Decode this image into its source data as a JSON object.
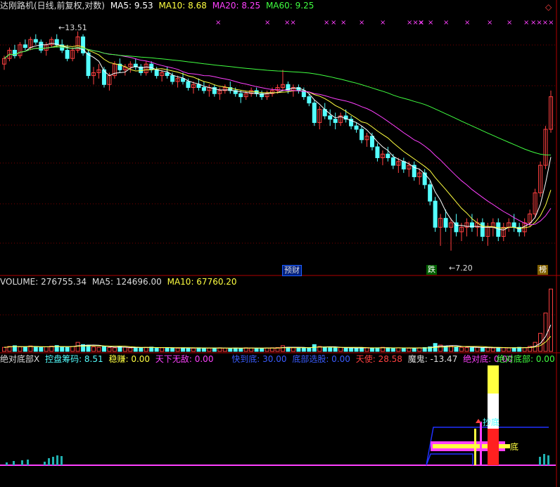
{
  "header": {
    "title": "达刚路机(日线,前复权,对数)",
    "ma5_label": "MA5: 9.53",
    "ma10_label": "MA10: 8.68",
    "ma20_label": "MA20: 8.25",
    "ma60_label": "MA60: 9.25",
    "diamond": "◇"
  },
  "colors": {
    "up": "#ff4040",
    "down": "#54ffff",
    "ma5": "#ffffff",
    "ma10": "#ffff40",
    "ma20": "#ff40ff",
    "ma60": "#40ff40",
    "grid": "#7a0000",
    "axis": "#b00000"
  },
  "price": {
    "high_label": "13.51",
    "low_label": "7.20",
    "tag_a": "预财",
    "tag_b": "跌",
    "tag_c": "榜",
    "x_marks": [
      "×",
      "×",
      "××",
      "×",
      "×",
      "×",
      "×",
      "×",
      "×××",
      "×",
      "×",
      "×",
      "×",
      "×",
      "×",
      "×",
      "××××"
    ]
  },
  "volume": {
    "label": "VOLUME: 276755.34",
    "ma5": "MA5: 124696.00",
    "ma10": "MA10: 67760.20"
  },
  "indicator": {
    "name": "绝对底部X",
    "kpcm": "控盘筹码: 8.51",
    "wenz": "稳赚: 0.00",
    "tianxia": "天下无敌: 0.00",
    "kuaidaodi": "快到底: 30.00",
    "dibu": "底部选股: 0.00",
    "tianshi": "天使: 28.58",
    "mogui": "魔鬼: -13.47",
    "juedidi": "绝对底: 0.00",
    "juedibu": "绝对底部: 0.00",
    "chaodi": "抄底",
    "dilabel": "底"
  },
  "chart_data": {
    "type": "candlestick",
    "price_axis": "log",
    "y_range": [
      6.8,
      14.2
    ],
    "candles": [
      [
        12.3,
        12.6,
        12.1,
        12.5
      ],
      [
        12.5,
        12.9,
        12.4,
        12.8
      ],
      [
        12.8,
        13.0,
        12.5,
        12.6
      ],
      [
        12.6,
        13.1,
        12.5,
        13.0
      ],
      [
        13.0,
        13.2,
        12.8,
        12.9
      ],
      [
        12.9,
        13.3,
        12.8,
        13.2
      ],
      [
        13.2,
        13.4,
        13.0,
        13.1
      ],
      [
        13.1,
        13.2,
        12.7,
        12.8
      ],
      [
        12.8,
        13.1,
        12.6,
        13.0
      ],
      [
        13.0,
        13.3,
        12.9,
        13.2
      ],
      [
        13.2,
        13.4,
        12.9,
        13.0
      ],
      [
        13.0,
        13.2,
        12.7,
        12.8
      ],
      [
        12.8,
        13.0,
        12.4,
        12.5
      ],
      [
        12.5,
        12.9,
        12.4,
        12.8
      ],
      [
        12.8,
        13.51,
        12.7,
        13.3
      ],
      [
        13.3,
        13.4,
        12.6,
        12.7
      ],
      [
        12.7,
        12.8,
        11.8,
        11.9
      ],
      [
        11.9,
        12.2,
        11.6,
        12.0
      ],
      [
        12.0,
        12.3,
        11.8,
        12.1
      ],
      [
        12.1,
        12.2,
        11.5,
        11.6
      ],
      [
        11.6,
        12.0,
        11.4,
        11.9
      ],
      [
        11.9,
        12.4,
        11.8,
        12.3
      ],
      [
        12.3,
        12.5,
        12.0,
        12.1
      ],
      [
        12.1,
        12.3,
        11.9,
        12.2
      ],
      [
        12.2,
        12.4,
        12.0,
        12.3
      ],
      [
        12.3,
        12.5,
        12.1,
        12.2
      ],
      [
        12.2,
        12.3,
        11.9,
        12.0
      ],
      [
        12.0,
        12.4,
        11.9,
        12.3
      ],
      [
        12.3,
        12.4,
        12.0,
        12.1
      ],
      [
        12.1,
        12.2,
        11.8,
        11.9
      ],
      [
        11.9,
        12.1,
        11.7,
        12.0
      ],
      [
        12.0,
        12.2,
        11.8,
        11.9
      ],
      [
        11.9,
        12.0,
        11.6,
        11.7
      ],
      [
        11.7,
        11.9,
        11.5,
        11.8
      ],
      [
        11.8,
        12.0,
        11.6,
        11.7
      ],
      [
        11.7,
        11.8,
        11.4,
        11.5
      ],
      [
        11.5,
        11.7,
        11.3,
        11.6
      ],
      [
        11.6,
        11.8,
        11.4,
        11.5
      ],
      [
        11.5,
        11.7,
        11.3,
        11.4
      ],
      [
        11.4,
        11.6,
        11.2,
        11.5
      ],
      [
        11.5,
        11.6,
        11.2,
        11.3
      ],
      [
        11.3,
        11.5,
        11.1,
        11.4
      ],
      [
        11.4,
        11.6,
        11.3,
        11.5
      ],
      [
        11.5,
        11.7,
        11.3,
        11.4
      ],
      [
        11.4,
        11.5,
        11.2,
        11.3
      ],
      [
        11.3,
        11.4,
        11.0,
        11.2
      ],
      [
        11.2,
        11.4,
        11.1,
        11.3
      ],
      [
        11.3,
        11.5,
        11.2,
        11.4
      ],
      [
        11.4,
        11.5,
        11.2,
        11.3
      ],
      [
        11.3,
        11.4,
        11.1,
        11.2
      ],
      [
        11.2,
        11.4,
        11.1,
        11.3
      ],
      [
        11.3,
        11.5,
        11.2,
        11.4
      ],
      [
        11.4,
        11.6,
        11.3,
        11.5
      ],
      [
        11.5,
        12.1,
        11.4,
        11.6
      ],
      [
        11.6,
        11.7,
        11.3,
        11.4
      ],
      [
        11.4,
        11.6,
        11.2,
        11.5
      ],
      [
        11.5,
        11.6,
        11.3,
        11.4
      ],
      [
        11.4,
        11.5,
        11.1,
        11.2
      ],
      [
        11.2,
        11.3,
        10.9,
        11.0
      ],
      [
        11.0,
        11.1,
        10.3,
        10.4
      ],
      [
        10.4,
        10.9,
        10.2,
        10.8
      ],
      [
        10.8,
        11.0,
        10.5,
        10.6
      ],
      [
        10.6,
        10.8,
        10.3,
        10.5
      ],
      [
        10.5,
        10.7,
        10.2,
        10.4
      ],
      [
        10.4,
        10.7,
        10.3,
        10.6
      ],
      [
        10.6,
        10.8,
        10.4,
        10.5
      ],
      [
        10.5,
        10.6,
        10.2,
        10.3
      ],
      [
        10.3,
        10.4,
        10.1,
        10.2
      ],
      [
        10.2,
        10.3,
        9.8,
        9.9
      ],
      [
        9.9,
        10.1,
        9.7,
        10.0
      ],
      [
        10.0,
        10.1,
        9.6,
        9.7
      ],
      [
        9.7,
        9.8,
        9.3,
        9.4
      ],
      [
        9.4,
        9.6,
        9.2,
        9.5
      ],
      [
        9.5,
        9.7,
        9.3,
        9.4
      ],
      [
        9.4,
        9.5,
        9.1,
        9.2
      ],
      [
        9.2,
        9.4,
        9.0,
        9.3
      ],
      [
        9.3,
        9.4,
        9.0,
        9.1
      ],
      [
        9.1,
        9.3,
        8.9,
        9.2
      ],
      [
        9.2,
        9.3,
        8.8,
        8.9
      ],
      [
        8.9,
        9.1,
        8.7,
        9.0
      ],
      [
        9.0,
        9.1,
        8.6,
        8.7
      ],
      [
        8.7,
        8.8,
        8.2,
        8.3
      ],
      [
        8.3,
        8.4,
        7.6,
        7.7
      ],
      [
        7.7,
        8.0,
        7.3,
        7.9
      ],
      [
        7.9,
        8.1,
        7.6,
        7.7
      ],
      [
        7.7,
        7.9,
        7.2,
        7.8
      ],
      [
        7.8,
        8.0,
        7.5,
        7.6
      ],
      [
        7.6,
        7.8,
        7.4,
        7.7
      ],
      [
        7.7,
        7.9,
        7.5,
        7.8
      ],
      [
        7.8,
        8.0,
        7.6,
        7.7
      ],
      [
        7.7,
        7.9,
        7.5,
        7.8
      ],
      [
        7.8,
        7.9,
        7.4,
        7.5
      ],
      [
        7.5,
        7.8,
        7.3,
        7.7
      ],
      [
        7.7,
        7.9,
        7.5,
        7.8
      ],
      [
        7.8,
        7.9,
        7.4,
        7.5
      ],
      [
        7.5,
        7.8,
        7.4,
        7.7
      ],
      [
        7.7,
        7.9,
        7.6,
        7.8
      ],
      [
        7.8,
        8.0,
        7.6,
        7.7
      ],
      [
        7.7,
        7.8,
        7.5,
        7.6
      ],
      [
        7.6,
        7.9,
        7.5,
        7.8
      ],
      [
        7.8,
        8.1,
        7.7,
        8.0
      ],
      [
        8.0,
        8.6,
        7.9,
        8.5
      ],
      [
        8.5,
        9.3,
        8.4,
        9.2
      ],
      [
        9.2,
        10.3,
        9.1,
        10.2
      ],
      [
        10.2,
        11.4,
        10.1,
        11.2
      ]
    ],
    "volume": [
      18,
      22,
      25,
      20,
      19,
      24,
      21,
      17,
      20,
      23,
      26,
      19,
      18,
      22,
      40,
      30,
      28,
      20,
      18,
      22,
      17,
      16,
      20,
      18,
      15,
      17,
      16,
      18,
      19,
      15,
      16,
      17,
      15,
      14,
      16,
      15,
      14,
      16,
      15,
      14,
      15,
      16,
      14,
      13,
      15,
      14,
      16,
      15,
      14,
      13,
      15,
      16,
      17,
      25,
      18,
      16,
      15,
      14,
      16,
      30,
      22,
      18,
      16,
      15,
      17,
      16,
      15,
      14,
      16,
      17,
      15,
      16,
      18,
      15,
      14,
      16,
      15,
      14,
      15,
      16,
      17,
      20,
      35,
      28,
      22,
      24,
      20,
      18,
      17,
      16,
      18,
      17,
      16,
      15,
      16,
      17,
      15,
      16,
      18,
      17,
      22,
      40,
      80,
      170,
      276
    ],
    "vol_max": 280
  }
}
